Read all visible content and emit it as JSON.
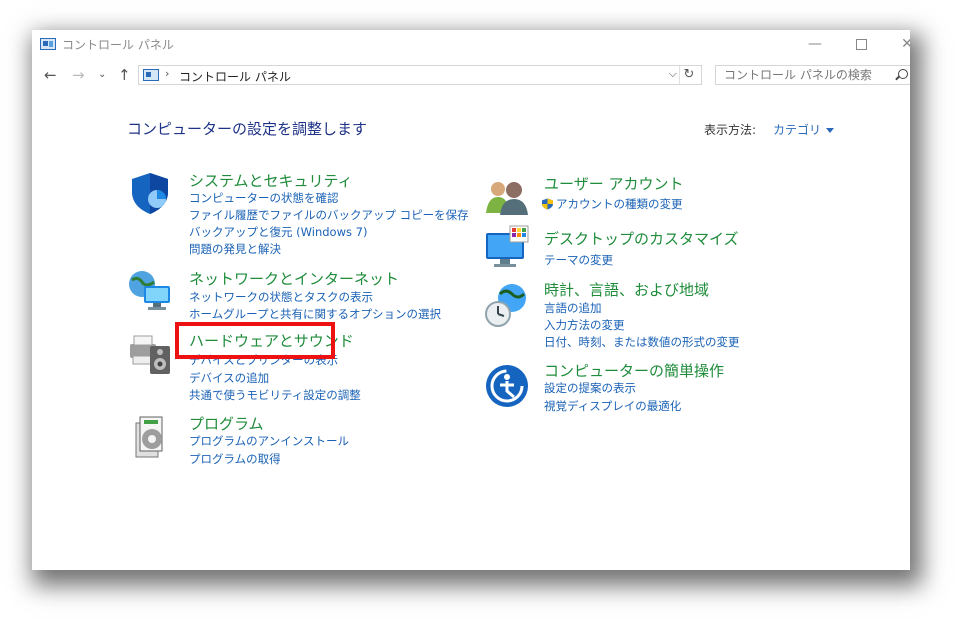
{
  "window": {
    "title": "コントロール パネル",
    "controls": {
      "minimize": "—",
      "close": "✕"
    }
  },
  "address": {
    "separator": "›",
    "path": "コントロール パネル",
    "dropdown": "⌵",
    "refresh": "↻"
  },
  "search": {
    "placeholder": "コントロール パネルの検索"
  },
  "nav": {
    "back": "←",
    "forward": "→",
    "recent": "⌄",
    "up": "↑"
  },
  "header": {
    "title": "コンピューターの設定を調整します",
    "view_label": "表示方法:",
    "view_value": "カテゴリ"
  },
  "left": [
    {
      "title": "システムとセキュリティ",
      "links": [
        "コンピューターの状態を確認",
        "ファイル履歴でファイルのバックアップ コピーを保存",
        "バックアップと復元 (Windows 7)",
        "問題の発見と解決"
      ]
    },
    {
      "title": "ネットワークとインターネット",
      "links": [
        "ネットワークの状態とタスクの表示",
        "ホームグループと共有に関するオプションの選択"
      ]
    },
    {
      "title": "ハードウェアとサウンド",
      "links": [
        "デバイスとプリンターの表示",
        "デバイスの追加",
        "共通で使うモビリティ設定の調整"
      ]
    },
    {
      "title": "プログラム",
      "links": [
        "プログラムのアンインストール",
        "プログラムの取得"
      ]
    }
  ],
  "right": [
    {
      "title": "ユーザー アカウント",
      "links": [
        "アカウントの種類の変更"
      ]
    },
    {
      "title": "デスクトップのカスタマイズ",
      "links": [
        "テーマの変更"
      ]
    },
    {
      "title": "時計、言語、および地域",
      "links": [
        "言語の追加",
        "入力方法の変更",
        "日付、時刻、または数値の形式の変更"
      ]
    },
    {
      "title": "コンピューターの簡単操作",
      "links": [
        "設定の提案の表示",
        "視覚ディスプレイの最適化"
      ]
    }
  ],
  "colors": {
    "title_green": "#1e8c3a",
    "link_blue": "#1a62b6",
    "highlight_red": "#ee1111"
  }
}
